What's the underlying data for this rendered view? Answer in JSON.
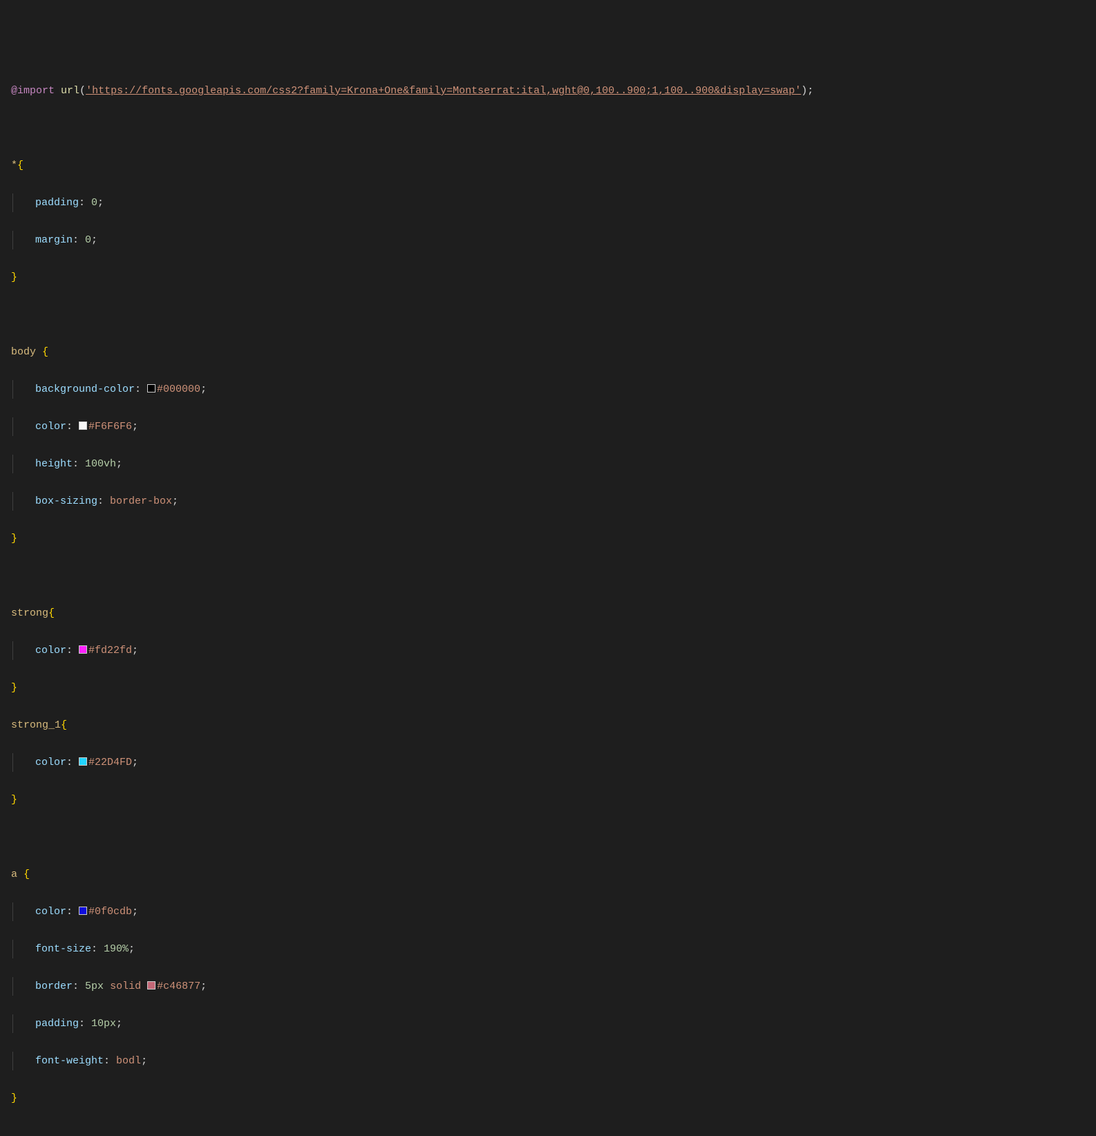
{
  "l1": {
    "import": "@import",
    "url": "url",
    "open": "(",
    "str": "'https://fonts.googleapis.com/css2?family=Krona+One&family=Montserrat:ital,wght@0,100..900;1,100..900&display=swap'",
    "close": ")",
    "semi": ";"
  },
  "r1": {
    "sel": "*",
    "open": "{",
    "close": "}",
    "p1": {
      "k": "padding",
      "c": ": ",
      "v": "0",
      "s": ";"
    },
    "p2": {
      "k": "margin",
      "c": ": ",
      "v": "0",
      "s": ";"
    }
  },
  "r2": {
    "sel": "body ",
    "open": "{",
    "close": "}",
    "p1": {
      "k": "background-color",
      "c": ": ",
      "sw": "#000000",
      "v": "#000000",
      "s": ";"
    },
    "p2": {
      "k": "color",
      "c": ": ",
      "sw": "#F6F6F6",
      "v": "#F6F6F6",
      "s": ";"
    },
    "p3": {
      "k": "height",
      "c": ": ",
      "v": "100vh",
      "s": ";"
    },
    "p4": {
      "k": "box-sizing",
      "c": ": ",
      "v": "border-box",
      "s": ";"
    }
  },
  "r3": {
    "sel": "strong",
    "open": "{",
    "close": "}",
    "p1": {
      "k": "color",
      "c": ": ",
      "sw": "#fd22fd",
      "v": "#fd22fd",
      "s": ";"
    }
  },
  "r4": {
    "sel": "strong_1",
    "open": "{",
    "close": "}",
    "p1": {
      "k": "color",
      "c": ": ",
      "sw": "#22D4FD",
      "v": "#22D4FD",
      "s": ";"
    }
  },
  "r5": {
    "sel": "a ",
    "open": "{",
    "close": "}",
    "p1": {
      "k": "color",
      "c": ": ",
      "sw": "#0f0cdb",
      "v": "#0f0cdb",
      "s": ";"
    },
    "p2": {
      "k": "font-size",
      "c": ": ",
      "v": "190%",
      "s": ";"
    },
    "p3": {
      "k": "border",
      "c": ": ",
      "v1": "5px",
      "sp1": " ",
      "v2": "solid",
      "sp2": " ",
      "sw": "#c46877",
      "v3": "#c46877",
      "s": ";"
    },
    "p4": {
      "k": "padding",
      "c": ": ",
      "v": "10px",
      "s": ";"
    },
    "p5": {
      "k": "font-weight",
      "c": ": ",
      "v": "bodl",
      "s": ";"
    }
  }
}
